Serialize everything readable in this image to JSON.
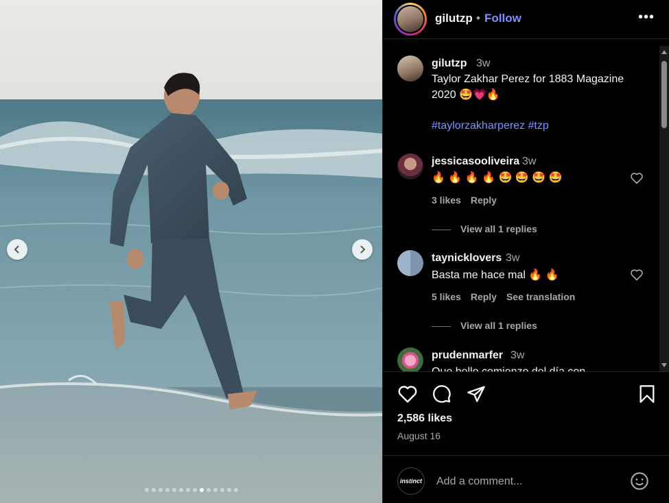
{
  "post": {
    "username": "gilutzp",
    "separator": "•",
    "follow_label": "Follow",
    "more_label": "•••"
  },
  "caption": {
    "username": "gilutzp",
    "time": "3w",
    "text_line1": "Taylor Zakhar Perez for 1883 Magazine",
    "text_line2": "2020 🤩💗🔥",
    "hashtags": "#taylorzakharperez #tzp"
  },
  "comments": [
    {
      "username": "jessicasooliveira",
      "time": "3w",
      "text": "🔥 🔥 🔥 🔥 🤩 🤩 🤩 🤩",
      "likes": "3 likes",
      "reply": "Reply",
      "view_replies": "View all 1 replies"
    },
    {
      "username": "taynicklovers",
      "time": "3w",
      "text": "Basta me hace mal 🔥 🔥",
      "likes": "5 likes",
      "reply": "Reply",
      "see_translation": "See translation",
      "view_replies": "View all 1 replies"
    },
    {
      "username": "prudenmarfer",
      "time": "3w",
      "text": "Que bello comienzo del día con"
    }
  ],
  "stats": {
    "likes": "2,586 likes",
    "date": "August 16"
  },
  "composer": {
    "self_avatar_label": "instinct",
    "placeholder": "Add a comment..."
  },
  "carousel": {
    "slide_count": 14,
    "active_index": 8
  },
  "colors": {
    "background": "#000000",
    "link_blue": "#7c93ff",
    "secondary_text": "#a8a8a8",
    "border": "#262626"
  }
}
